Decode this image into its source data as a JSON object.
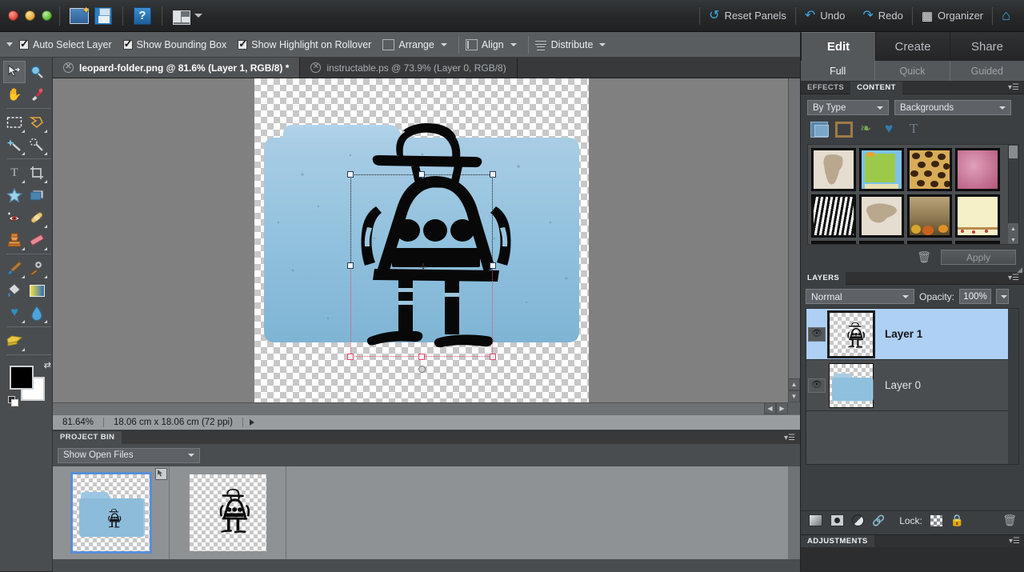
{
  "topbar": {
    "window_controls": [
      "close",
      "minimize",
      "zoom"
    ],
    "tools": [
      {
        "name": "new-file",
        "label": "New File"
      },
      {
        "name": "save",
        "label": "Save"
      },
      {
        "name": "help",
        "label": "?"
      },
      {
        "name": "layout",
        "label": "Layout"
      }
    ],
    "right_items": [
      {
        "name": "reset-panels",
        "label": "Reset Panels",
        "icon": "refresh-icon"
      },
      {
        "name": "undo",
        "label": "Undo",
        "icon": "undo-arrow-icon"
      },
      {
        "name": "redo",
        "label": "Redo",
        "icon": "redo-arrow-icon"
      },
      {
        "name": "organizer",
        "label": "Organizer",
        "icon": "grid-icon"
      }
    ],
    "home_icon": "home-icon",
    "accent_color": "#3ea9e0"
  },
  "options_bar": {
    "checkboxes": [
      {
        "label": "Auto Select Layer",
        "checked": true
      },
      {
        "label": "Show Bounding Box",
        "checked": true
      },
      {
        "label": "Show Highlight on Rollover",
        "checked": true
      }
    ],
    "menus": [
      {
        "label": "Arrange",
        "icon": "arrange-icon"
      },
      {
        "label": "Align",
        "icon": "align-icon"
      },
      {
        "label": "Distribute",
        "icon": "distribute-icon"
      }
    ]
  },
  "toolbox": {
    "tools": [
      {
        "name": "move-tool",
        "glyph": "↖",
        "active": true,
        "has_flyout": false
      },
      {
        "name": "zoom-tool",
        "glyph": "○",
        "active": false,
        "has_flyout": false
      },
      {
        "name": "hand-tool",
        "glyph": "✋",
        "active": false,
        "has_flyout": false
      },
      {
        "name": "eyedropper-tool",
        "glyph": "✒",
        "active": false,
        "has_flyout": false
      },
      {
        "name": "rectangular-marquee-tool",
        "glyph": "⬚",
        "active": false,
        "has_flyout": true
      },
      {
        "name": "lasso-tool",
        "glyph": "➿",
        "active": false,
        "has_flyout": true
      },
      {
        "name": "magic-wand-tool",
        "glyph": "✦",
        "active": false,
        "has_flyout": true
      },
      {
        "name": "selection-brush-tool",
        "glyph": "◌",
        "active": false,
        "has_flyout": true
      },
      {
        "name": "type-tool",
        "glyph": "T",
        "active": false,
        "has_flyout": true
      },
      {
        "name": "crop-tool",
        "glyph": "⌗",
        "active": false,
        "has_flyout": true
      },
      {
        "name": "cookie-cutter-tool",
        "glyph": "☆",
        "active": false,
        "has_flyout": false
      },
      {
        "name": "straighten-tool",
        "glyph": "▭",
        "active": false,
        "has_flyout": false
      },
      {
        "name": "red-eye-removal-tool",
        "glyph": "◉",
        "active": false,
        "has_flyout": false
      },
      {
        "name": "healing-brush-tool",
        "glyph": "╱",
        "active": false,
        "has_flyout": true
      },
      {
        "name": "clone-stamp-tool",
        "glyph": "⚑",
        "active": false,
        "has_flyout": true
      },
      {
        "name": "eraser-tool",
        "glyph": "▰",
        "active": false,
        "has_flyout": true
      },
      {
        "name": "brush-tool",
        "glyph": "✐",
        "active": false,
        "has_flyout": true
      },
      {
        "name": "smart-brush-tool",
        "glyph": "⚙",
        "active": false,
        "has_flyout": true
      },
      {
        "name": "paint-bucket-tool",
        "glyph": "◢",
        "active": false,
        "has_flyout": false
      },
      {
        "name": "gradient-tool",
        "glyph": "■",
        "active": false,
        "has_flyout": false
      },
      {
        "name": "shape-tool",
        "glyph": "♥",
        "active": false,
        "has_flyout": true
      },
      {
        "name": "blur-tool",
        "glyph": "●",
        "active": false,
        "has_flyout": true
      },
      {
        "name": "sponge-tool",
        "glyph": "▭",
        "active": false,
        "has_flyout": true
      }
    ],
    "foreground_color": "#000000",
    "background_color": "#ffffff"
  },
  "document_tabs": [
    {
      "title": "leopard-folder.png @ 81.6% (Layer 1, RGB/8) *",
      "active": true
    },
    {
      "title": "instructable.ps @ 73.9% (Layer 0, RGB/8)",
      "active": false
    }
  ],
  "canvas": {
    "zoom": "81.64%",
    "dimensions": "18.06 cm x 18.06 cm (72 ppi)",
    "artwork": "blue-mac-folder-with-black-robot-silhouette",
    "transform_active": true
  },
  "project_bin": {
    "panel_title": "PROJECT BIN",
    "filter": "Show Open Files",
    "items": [
      {
        "name": "leopard-folder",
        "selected": true,
        "has_badge": true
      },
      {
        "name": "instructable-robot",
        "selected": false,
        "has_badge": false
      }
    ]
  },
  "right_panel": {
    "main_tabs": [
      {
        "label": "Edit",
        "active": true
      },
      {
        "label": "Create",
        "active": false
      },
      {
        "label": "Share",
        "active": false
      }
    ],
    "sub_tabs": [
      {
        "label": "Full",
        "active": true
      },
      {
        "label": "Quick",
        "active": false
      },
      {
        "label": "Guided",
        "active": false
      }
    ],
    "content_panel": {
      "tabs": [
        {
          "label": "EFFECTS",
          "active": false
        },
        {
          "label": "CONTENT",
          "active": true
        }
      ],
      "filter_by": "By Type",
      "filter_value": "Backgrounds",
      "category_icons": [
        "backgrounds-icon",
        "frames-icon",
        "graphics-icon",
        "shapes-icon",
        "text-icon"
      ],
      "thumbnails": [
        {
          "name": "africa-map-background",
          "color1": "#e4ddd0",
          "color2": "#b9a88e"
        },
        {
          "name": "green-blue-card-background",
          "color1": "#9dc94a",
          "color2": "#7dc3e8"
        },
        {
          "name": "leopard-print-background",
          "color1": "#d8ac57",
          "color2": "#3a2410"
        },
        {
          "name": "pink-texture-background",
          "color1": "#d4819f",
          "color2": "#b3557a"
        },
        {
          "name": "zebra-stripes-background",
          "color1": "#ffffff",
          "color2": "#1a1a1a"
        },
        {
          "name": "asia-map-background",
          "color1": "#e4ddd0",
          "color2": "#b9a88e"
        },
        {
          "name": "autumn-harvest-background",
          "color1": "#b9a37a",
          "color2": "#5e4a28"
        },
        {
          "name": "cream-berry-border-background",
          "color1": "#f5f0c8",
          "color2": "#c43b3b"
        }
      ],
      "delete_label": "delete",
      "apply_label": "Apply"
    },
    "layers_panel": {
      "title": "LAYERS",
      "blend_mode": "Normal",
      "opacity_label": "Opacity:",
      "opacity_value": "100%",
      "layers": [
        {
          "name": "Layer 1",
          "visible": true,
          "selected": true,
          "thumb": "robot"
        },
        {
          "name": "Layer 0",
          "visible": true,
          "selected": false,
          "thumb": "folder"
        }
      ],
      "footer_icons": [
        "gradient-layer-icon",
        "layer-mask-icon",
        "adjustment-layer-icon",
        "link-layers-icon"
      ],
      "lock_label": "Lock:",
      "lock_icons": [
        "lock-transparency-icon",
        "lock-all-icon"
      ],
      "trash_icon": "trash-icon",
      "selected_highlight_color": "#aed0f5"
    },
    "adjustments_panel": {
      "title": "ADJUSTMENTS"
    }
  }
}
